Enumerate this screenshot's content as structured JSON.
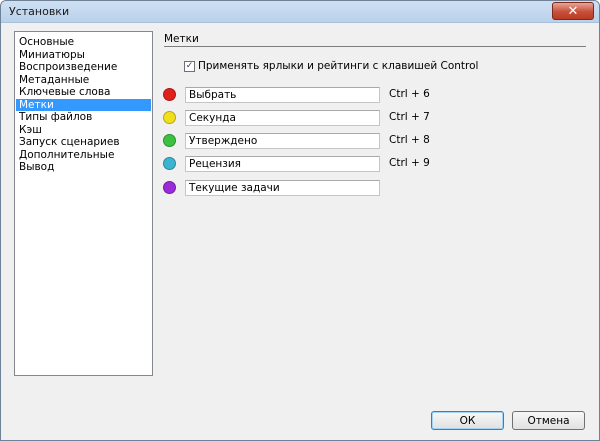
{
  "window": {
    "title": "Установки",
    "close_label": "✕"
  },
  "sidebar": {
    "items": [
      {
        "label": "Основные"
      },
      {
        "label": "Миниатюры"
      },
      {
        "label": "Воспроизведение"
      },
      {
        "label": "Метаданные"
      },
      {
        "label": "Ключевые слова"
      },
      {
        "label": "Метки",
        "selected": true
      },
      {
        "label": "Типы файлов"
      },
      {
        "label": "Кэш"
      },
      {
        "label": "Запуск сценариев"
      },
      {
        "label": "Дополнительные"
      },
      {
        "label": "Вывод"
      }
    ]
  },
  "section": {
    "title": "Метки"
  },
  "control_option": {
    "label": "Применять ярлыки и рейтинги с клавишей Control",
    "checked": true,
    "check_glyph": "✓"
  },
  "labels": [
    {
      "name": "Выбрать",
      "shortcut": "Ctrl + 6",
      "color": "#e0201b"
    },
    {
      "name": "Секунда",
      "shortcut": "Ctrl + 7",
      "color": "#f2df1c"
    },
    {
      "name": "Утверждено",
      "shortcut": "Ctrl + 8",
      "color": "#3cc03f"
    },
    {
      "name": "Рецензия",
      "shortcut": "Ctrl + 9",
      "color": "#3bb5cf"
    },
    {
      "name": "Текущие задачи",
      "shortcut": "",
      "color": "#9a2bd8"
    }
  ],
  "buttons": {
    "ok": "ОК",
    "cancel": "Отмена"
  }
}
